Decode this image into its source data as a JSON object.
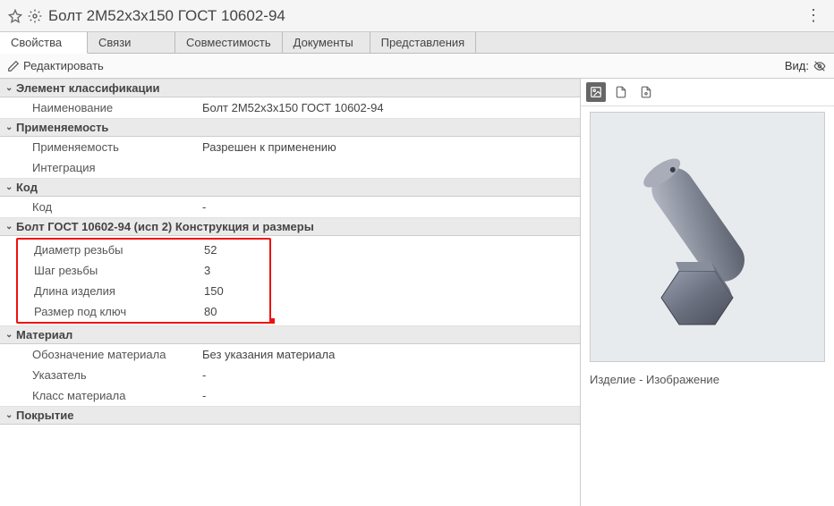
{
  "title": "Болт 2М52х3х150 ГОСТ 10602-94",
  "tabs": {
    "properties": "Свойства",
    "relations": "Связи",
    "compatibility": "Совместимость",
    "documents": "Документы",
    "views": "Представления"
  },
  "toolbar": {
    "edit": "Редактировать",
    "view_label": "Вид:"
  },
  "sections": {
    "classification": {
      "title": "Элемент классификации",
      "name_label": "Наименование",
      "name_value": "Болт 2М52х3х150 ГОСТ 10602-94"
    },
    "applicability": {
      "title": "Применяемость",
      "label": "Применяемость",
      "value": "Разрешен к применению",
      "integration": "Интеграция"
    },
    "code": {
      "title": "Код",
      "label": "Код",
      "value": "-"
    },
    "dimensions": {
      "title": "Болт ГОСТ 10602-94 (исп 2) Конструкция и размеры",
      "thread_dia_label": "Диаметр резьбы",
      "thread_dia_value": "52",
      "pitch_label": "Шаг резьбы",
      "pitch_value": "3",
      "length_label": "Длина изделия",
      "length_value": "150",
      "wrench_label": "Размер под ключ",
      "wrench_value": "80"
    },
    "material": {
      "title": "Материал",
      "designation_label": "Обозначение материала",
      "designation_value": "Без указания материала",
      "indicator_label": "Указатель",
      "indicator_value": "-",
      "class_label": "Класс материала",
      "class_value": "-"
    },
    "coating": {
      "title": "Покрытие"
    }
  },
  "preview": {
    "caption": "Изделие  -  Изображение"
  }
}
